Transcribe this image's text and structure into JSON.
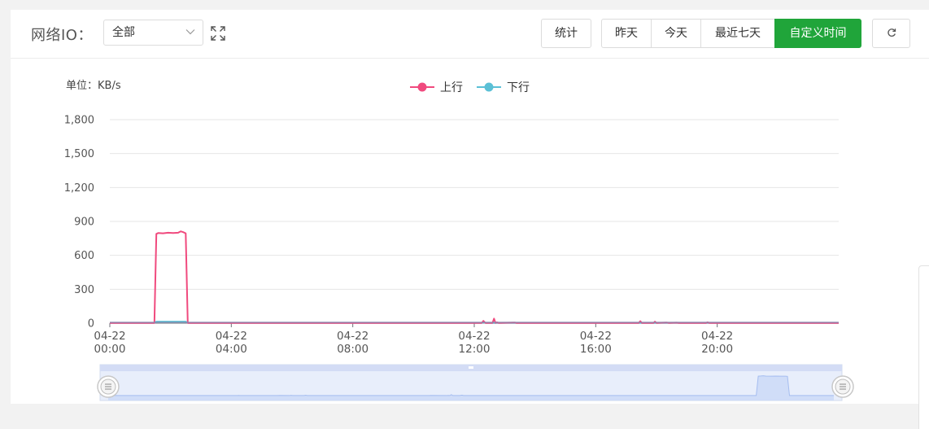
{
  "header": {
    "title": "网络IO：",
    "select_value": "全部",
    "stats_label": "统计",
    "range_buttons": [
      "昨天",
      "今天",
      "最近七天",
      "自定义时间"
    ],
    "active_range": "自定义时间",
    "accent_color": "#20a53a"
  },
  "icons": {
    "select": "chevron-down-icon",
    "fullscreen": "expand-icon",
    "refresh": "refresh-icon"
  },
  "chart_data": {
    "type": "line",
    "unit_label": "单位：KB/s",
    "ylim": [
      0,
      1800
    ],
    "yticks": [
      "1,800",
      "1,500",
      "1,200",
      "900",
      "600",
      "300",
      "0"
    ],
    "ytick_values": [
      1800,
      1500,
      1200,
      900,
      600,
      300,
      0
    ],
    "xlim": [
      0,
      1440
    ],
    "xticks": [
      {
        "minute": 0,
        "date": "04-22",
        "time": "00:00"
      },
      {
        "minute": 240,
        "date": "04-22",
        "time": "04:00"
      },
      {
        "minute": 480,
        "date": "04-22",
        "time": "08:00"
      },
      {
        "minute": 720,
        "date": "04-22",
        "time": "12:00"
      },
      {
        "minute": 960,
        "date": "04-22",
        "time": "16:00"
      },
      {
        "minute": 1200,
        "date": "04-22",
        "time": "20:00"
      }
    ],
    "grid": true,
    "legend_position": "top-center",
    "series": [
      {
        "name": "上行",
        "color": "#f04a7e",
        "points": [
          [
            0,
            2
          ],
          [
            88,
            2
          ],
          [
            92,
            790
          ],
          [
            96,
            798
          ],
          [
            105,
            795
          ],
          [
            115,
            800
          ],
          [
            125,
            797
          ],
          [
            135,
            800
          ],
          [
            140,
            812
          ],
          [
            145,
            805
          ],
          [
            150,
            795
          ],
          [
            154,
            2
          ],
          [
            735,
            2
          ],
          [
            738,
            20
          ],
          [
            742,
            2
          ],
          [
            756,
            2
          ],
          [
            759,
            40
          ],
          [
            762,
            2
          ],
          [
            765,
            8
          ],
          [
            768,
            2
          ],
          [
            800,
            6
          ],
          [
            803,
            2
          ],
          [
            1045,
            2
          ],
          [
            1048,
            18
          ],
          [
            1051,
            2
          ],
          [
            1074,
            2
          ],
          [
            1077,
            14
          ],
          [
            1080,
            2
          ],
          [
            1100,
            6
          ],
          [
            1104,
            2
          ],
          [
            1120,
            4
          ],
          [
            1124,
            2
          ],
          [
            1178,
            2
          ],
          [
            1181,
            8
          ],
          [
            1184,
            2
          ],
          [
            1440,
            2
          ]
        ]
      },
      {
        "name": "下行",
        "color": "#5bc0d6",
        "points": [
          [
            0,
            2
          ],
          [
            88,
            2
          ],
          [
            92,
            14
          ],
          [
            150,
            14
          ],
          [
            154,
            2
          ],
          [
            735,
            2
          ],
          [
            738,
            6
          ],
          [
            742,
            2
          ],
          [
            1440,
            2
          ]
        ]
      }
    ]
  }
}
